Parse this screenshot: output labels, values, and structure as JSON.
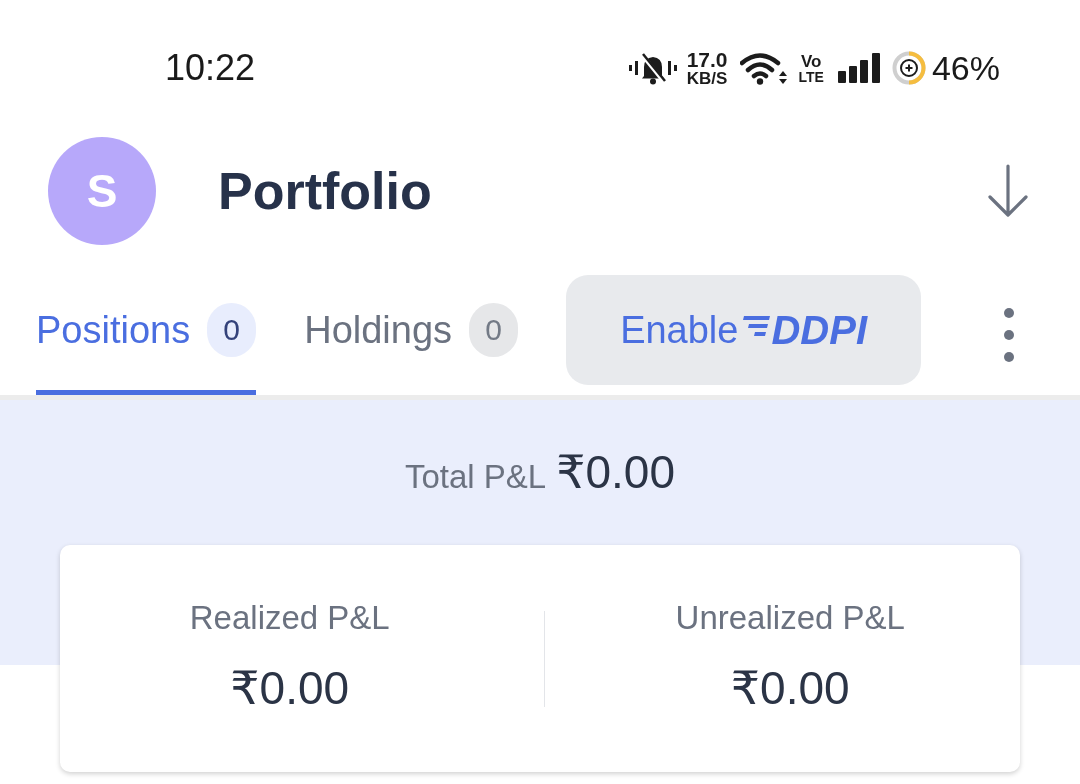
{
  "status_bar": {
    "time": "10:22",
    "network_speed": [
      "17.0",
      "KB/S"
    ],
    "network_type": [
      "Vo",
      "LTE"
    ],
    "battery": "46%"
  },
  "header": {
    "avatar_initial": "S",
    "title": "Portfolio"
  },
  "tabs": [
    {
      "label": "Positions",
      "count": "0",
      "selected": true
    },
    {
      "label": "Holdings",
      "count": "0",
      "selected": false
    }
  ],
  "ddpi_button": {
    "label": "Enable",
    "brand": "DDPI"
  },
  "total_pnl": {
    "label": "Total P&L",
    "value": "₹0.00"
  },
  "pnl_breakdown": [
    {
      "label": "Realized P&L",
      "value": "₹0.00"
    },
    {
      "label": "Unrealized P&L",
      "value": "₹0.00"
    }
  ]
}
